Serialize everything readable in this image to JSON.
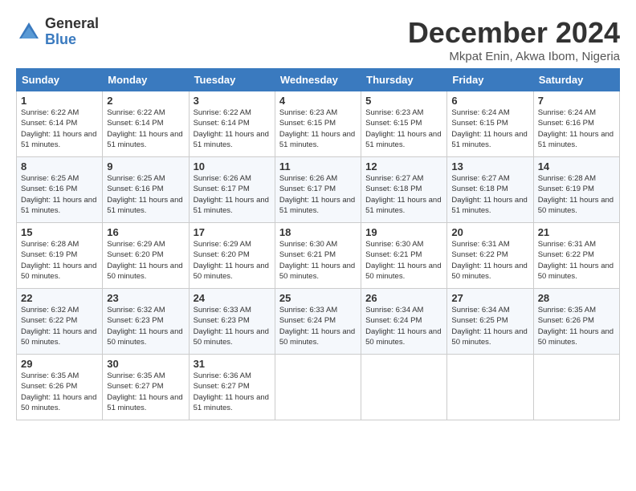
{
  "logo": {
    "general": "General",
    "blue": "Blue"
  },
  "title": "December 2024",
  "location": "Mkpat Enin, Akwa Ibom, Nigeria",
  "days_of_week": [
    "Sunday",
    "Monday",
    "Tuesday",
    "Wednesday",
    "Thursday",
    "Friday",
    "Saturday"
  ],
  "weeks": [
    [
      {
        "num": "1",
        "rise": "6:22 AM",
        "set": "6:14 PM",
        "hours": "11 hours and 51 minutes."
      },
      {
        "num": "2",
        "rise": "6:22 AM",
        "set": "6:14 PM",
        "hours": "11 hours and 51 minutes."
      },
      {
        "num": "3",
        "rise": "6:22 AM",
        "set": "6:14 PM",
        "hours": "11 hours and 51 minutes."
      },
      {
        "num": "4",
        "rise": "6:23 AM",
        "set": "6:15 PM",
        "hours": "11 hours and 51 minutes."
      },
      {
        "num": "5",
        "rise": "6:23 AM",
        "set": "6:15 PM",
        "hours": "11 hours and 51 minutes."
      },
      {
        "num": "6",
        "rise": "6:24 AM",
        "set": "6:15 PM",
        "hours": "11 hours and 51 minutes."
      },
      {
        "num": "7",
        "rise": "6:24 AM",
        "set": "6:16 PM",
        "hours": "11 hours and 51 minutes."
      }
    ],
    [
      {
        "num": "8",
        "rise": "6:25 AM",
        "set": "6:16 PM",
        "hours": "11 hours and 51 minutes."
      },
      {
        "num": "9",
        "rise": "6:25 AM",
        "set": "6:16 PM",
        "hours": "11 hours and 51 minutes."
      },
      {
        "num": "10",
        "rise": "6:26 AM",
        "set": "6:17 PM",
        "hours": "11 hours and 51 minutes."
      },
      {
        "num": "11",
        "rise": "6:26 AM",
        "set": "6:17 PM",
        "hours": "11 hours and 51 minutes."
      },
      {
        "num": "12",
        "rise": "6:27 AM",
        "set": "6:18 PM",
        "hours": "11 hours and 51 minutes."
      },
      {
        "num": "13",
        "rise": "6:27 AM",
        "set": "6:18 PM",
        "hours": "11 hours and 51 minutes."
      },
      {
        "num": "14",
        "rise": "6:28 AM",
        "set": "6:19 PM",
        "hours": "11 hours and 50 minutes."
      }
    ],
    [
      {
        "num": "15",
        "rise": "6:28 AM",
        "set": "6:19 PM",
        "hours": "11 hours and 50 minutes."
      },
      {
        "num": "16",
        "rise": "6:29 AM",
        "set": "6:20 PM",
        "hours": "11 hours and 50 minutes."
      },
      {
        "num": "17",
        "rise": "6:29 AM",
        "set": "6:20 PM",
        "hours": "11 hours and 50 minutes."
      },
      {
        "num": "18",
        "rise": "6:30 AM",
        "set": "6:21 PM",
        "hours": "11 hours and 50 minutes."
      },
      {
        "num": "19",
        "rise": "6:30 AM",
        "set": "6:21 PM",
        "hours": "11 hours and 50 minutes."
      },
      {
        "num": "20",
        "rise": "6:31 AM",
        "set": "6:22 PM",
        "hours": "11 hours and 50 minutes."
      },
      {
        "num": "21",
        "rise": "6:31 AM",
        "set": "6:22 PM",
        "hours": "11 hours and 50 minutes."
      }
    ],
    [
      {
        "num": "22",
        "rise": "6:32 AM",
        "set": "6:22 PM",
        "hours": "11 hours and 50 minutes."
      },
      {
        "num": "23",
        "rise": "6:32 AM",
        "set": "6:23 PM",
        "hours": "11 hours and 50 minutes."
      },
      {
        "num": "24",
        "rise": "6:33 AM",
        "set": "6:23 PM",
        "hours": "11 hours and 50 minutes."
      },
      {
        "num": "25",
        "rise": "6:33 AM",
        "set": "6:24 PM",
        "hours": "11 hours and 50 minutes."
      },
      {
        "num": "26",
        "rise": "6:34 AM",
        "set": "6:24 PM",
        "hours": "11 hours and 50 minutes."
      },
      {
        "num": "27",
        "rise": "6:34 AM",
        "set": "6:25 PM",
        "hours": "11 hours and 50 minutes."
      },
      {
        "num": "28",
        "rise": "6:35 AM",
        "set": "6:26 PM",
        "hours": "11 hours and 50 minutes."
      }
    ],
    [
      {
        "num": "29",
        "rise": "6:35 AM",
        "set": "6:26 PM",
        "hours": "11 hours and 50 minutes."
      },
      {
        "num": "30",
        "rise": "6:35 AM",
        "set": "6:27 PM",
        "hours": "11 hours and 51 minutes."
      },
      {
        "num": "31",
        "rise": "6:36 AM",
        "set": "6:27 PM",
        "hours": "11 hours and 51 minutes."
      },
      null,
      null,
      null,
      null
    ]
  ],
  "labels": {
    "sunrise": "Sunrise:",
    "sunset": "Sunset:",
    "daylight": "Daylight:"
  }
}
